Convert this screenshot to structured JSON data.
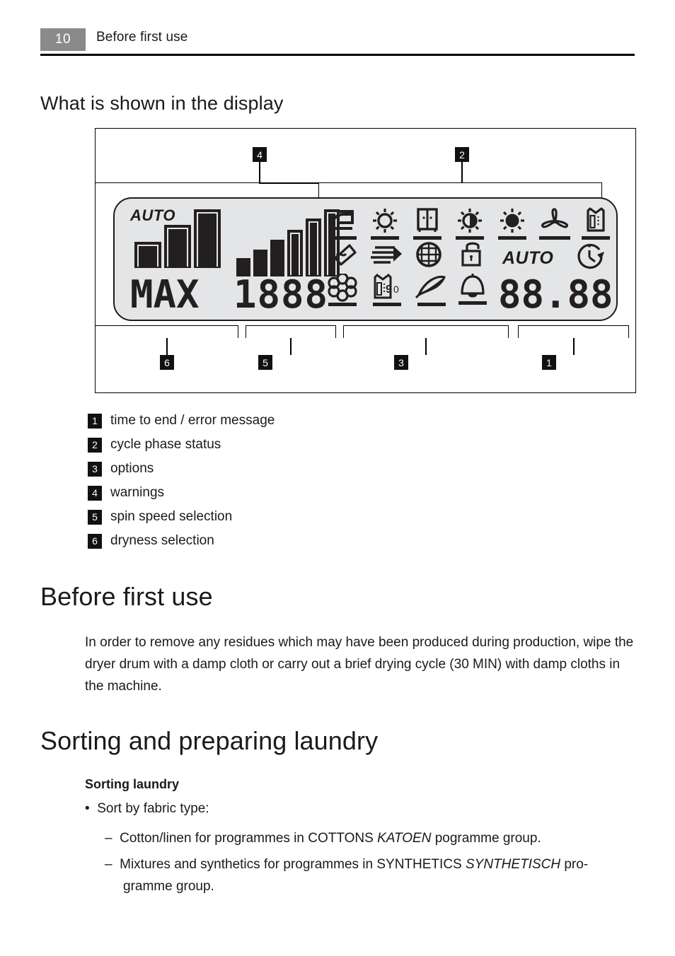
{
  "page": {
    "number": "10",
    "running_head": "Before first use"
  },
  "sections": {
    "display_heading": "What is shown in the display",
    "before_first_use_heading": "Before first use",
    "before_first_use_body": "In order to remove any residues which may have been produced during production, wipe the dryer drum with a damp cloth or carry out a brief drying cycle (30 MIN) with damp cloths in the machine.",
    "sorting_heading": "Sorting and preparing laundry",
    "sorting_subhead": "Sorting laundry",
    "bullet": "Sort by fabric type:",
    "dash1_pre": "Cotton/linen for programmes in COTTONS ",
    "dash1_italic": "KATOEN",
    "dash1_post": " pogramme group.",
    "dash2_pre": "Mixtures and synthetics for programmes in SYNTHETICS ",
    "dash2_italic": "SYNTHETISCH",
    "dash2_post": " pro-",
    "dash2_line2": "gramme group."
  },
  "figure": {
    "callouts": {
      "c1": "1",
      "c2": "2",
      "c3": "3",
      "c4": "4",
      "c5": "5",
      "c6": "6"
    },
    "lcd": {
      "dryness_auto_label": "AUTO",
      "dryness_bars": [
        34,
        60,
        82
      ],
      "spin_bars": [
        18,
        30,
        44,
        58,
        72,
        88
      ],
      "dryness_text": "MAX",
      "spin_text": "1888",
      "time_auto_label": "AUTO",
      "time_text": "88.88",
      "icons_row1": [
        "iron-icon",
        "sun-outline-icon",
        "wardrobe-icon",
        "sun-half-icon",
        "sun-filled-icon",
        "fan-icon",
        "shirt-icon"
      ],
      "icons_row2": [
        "water-tank-icon",
        "airflow-arrow-icon",
        "filter-mesh-icon",
        "child-lock-icon"
      ],
      "icons_row3": [
        "flower-icon",
        "shirt-90-icon",
        "feather-icon",
        "buzzer-bell-icon"
      ],
      "shirt_90_label": "9",
      "shirt_90_zero": "0",
      "delay_timer_icon": "delay-start-clock-icon"
    }
  },
  "legend": [
    {
      "num": "1",
      "label": "time to end / error message"
    },
    {
      "num": "2",
      "label": "cycle phase status"
    },
    {
      "num": "3",
      "label": "options"
    },
    {
      "num": "4",
      "label": "warnings"
    },
    {
      "num": "5",
      "label": "spin speed selection"
    },
    {
      "num": "6",
      "label": "dryness selection"
    }
  ],
  "colors": {
    "page_number_bg": "#8a8a8a",
    "lcd_bg": "#e4e5e6",
    "lcd_ink": "#231f20",
    "chip_bg": "#111111"
  }
}
